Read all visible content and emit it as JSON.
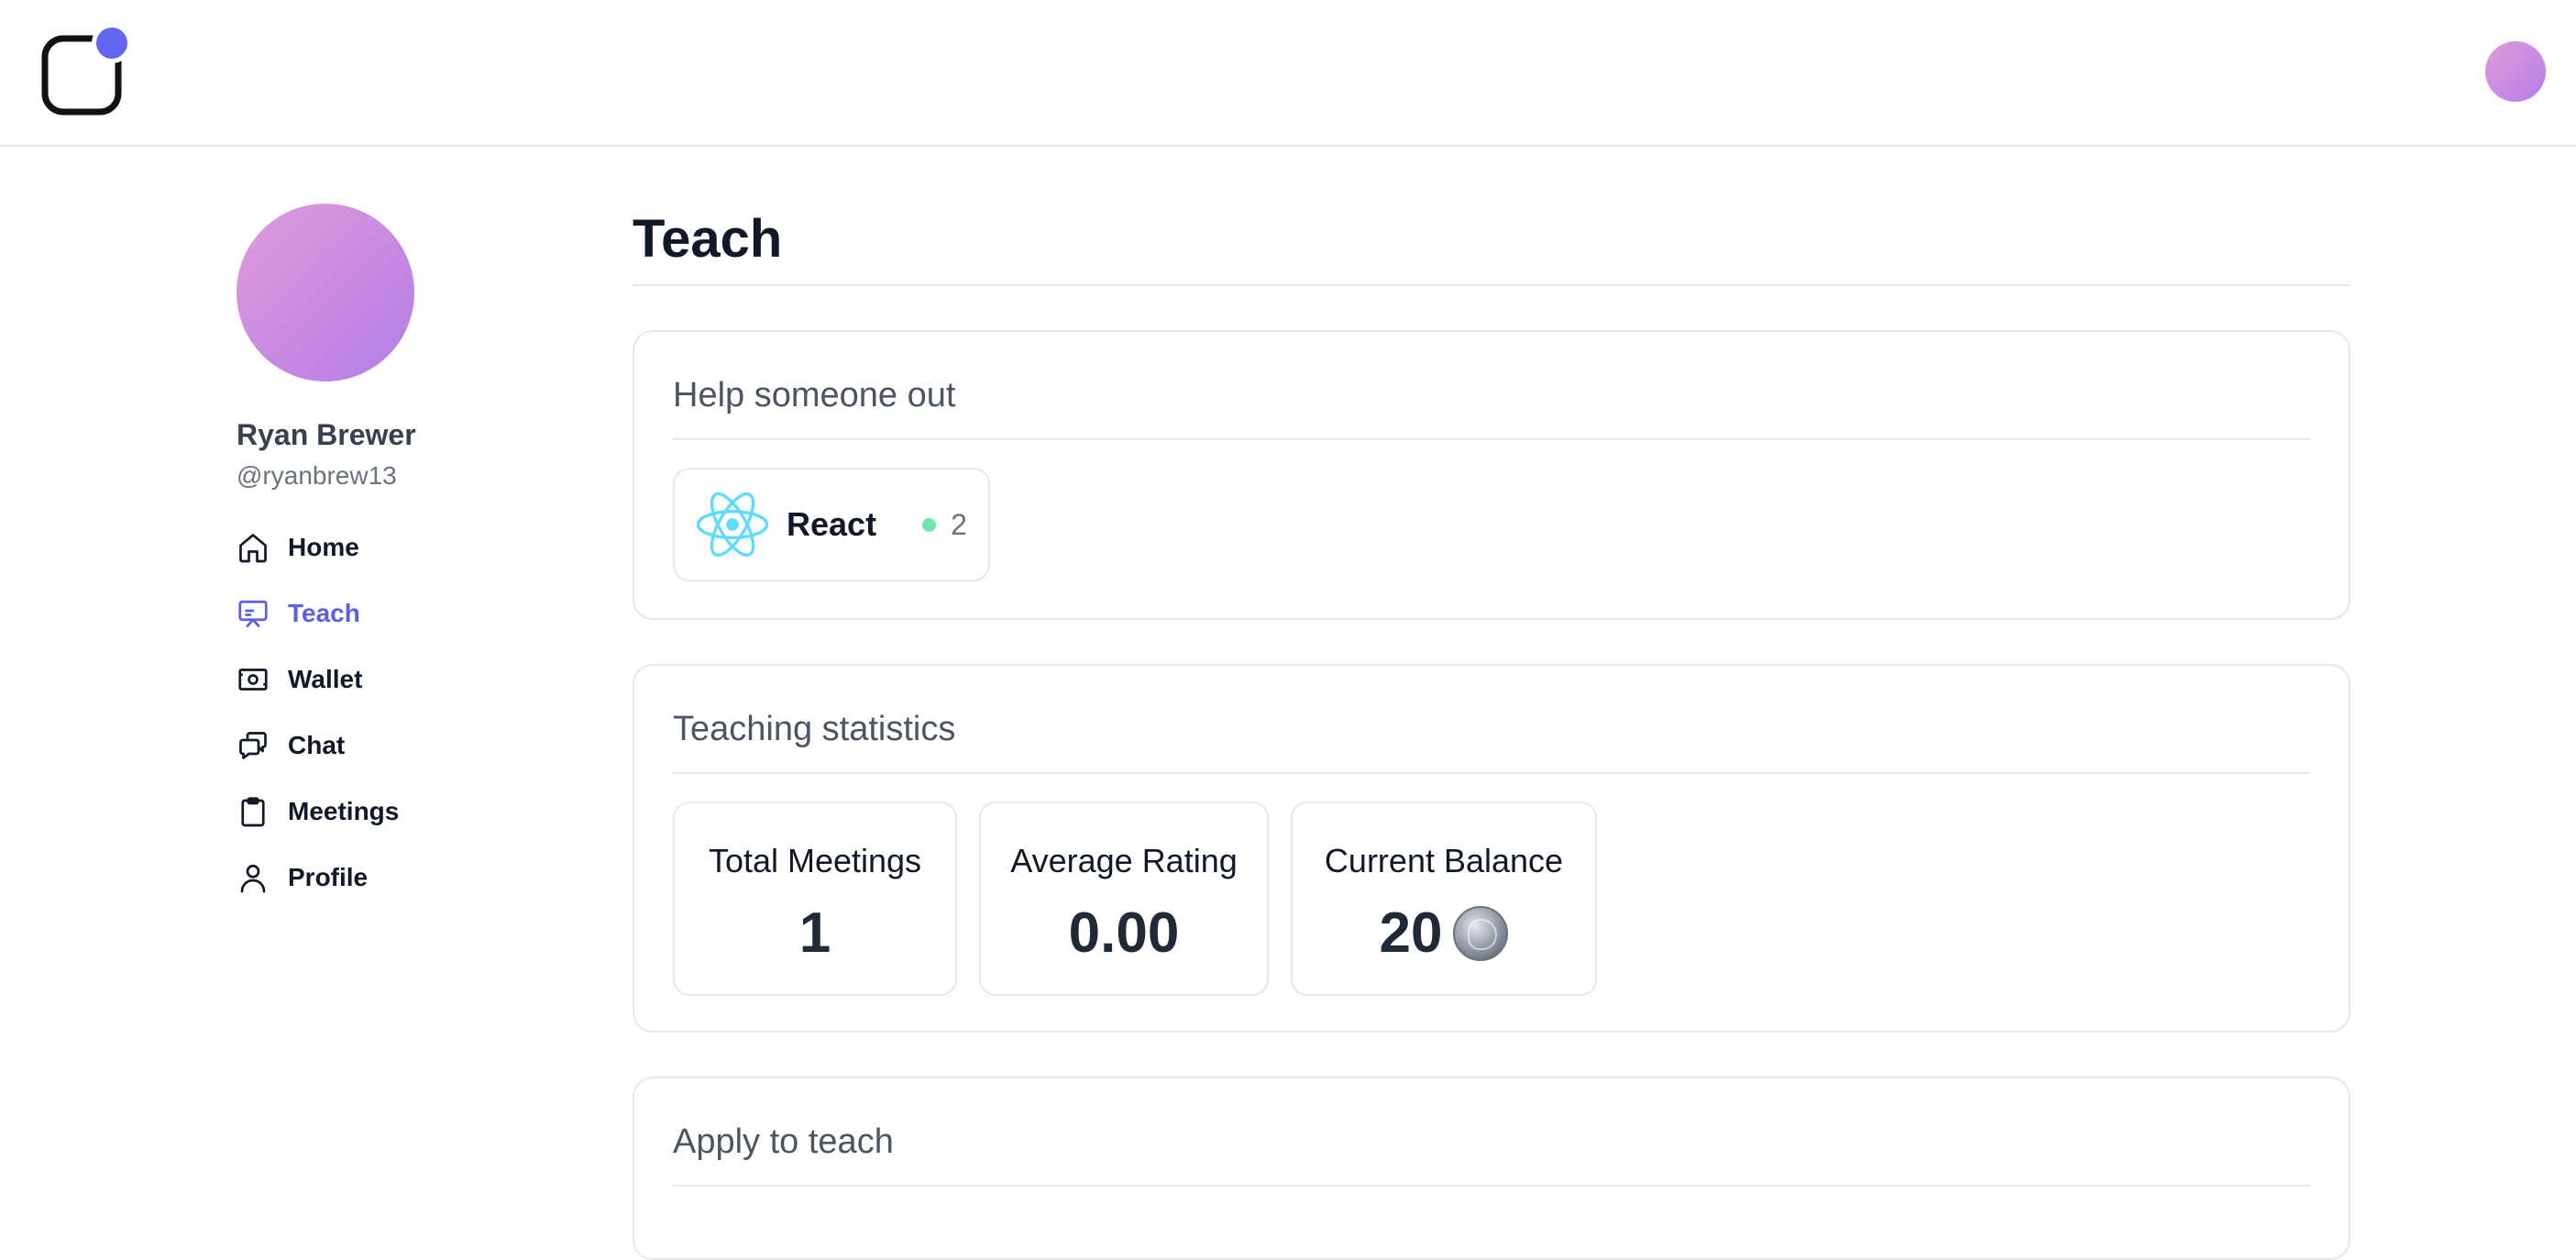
{
  "header": {
    "logo_icon": "app-logo-icon",
    "accent": "#6366f1",
    "avatar_icon": "user-avatar"
  },
  "sidebar": {
    "user": {
      "name": "Ryan Brewer",
      "handle": "@ryanbrew13"
    },
    "items": [
      {
        "label": "Home",
        "icon": "home-icon",
        "active": false
      },
      {
        "label": "Teach",
        "icon": "presentation-icon",
        "active": true
      },
      {
        "label": "Wallet",
        "icon": "cash-icon",
        "active": false
      },
      {
        "label": "Chat",
        "icon": "chat-icon",
        "active": false
      },
      {
        "label": "Meetings",
        "icon": "clipboard-icon",
        "active": false
      },
      {
        "label": "Profile",
        "icon": "user-icon",
        "active": false
      }
    ],
    "active_color": "#5b5fe0"
  },
  "main": {
    "title": "Teach",
    "help_card": {
      "title": "Help someone out",
      "topics": [
        {
          "name": "React",
          "icon": "react-icon",
          "count": "2",
          "status_color": "#6ee7a8"
        }
      ]
    },
    "stats_card": {
      "title": "Teaching statistics",
      "stats": [
        {
          "label": "Total Meetings",
          "value": "1"
        },
        {
          "label": "Average Rating",
          "value": "0.00"
        },
        {
          "label": "Current Balance",
          "value": "20",
          "icon": "coin-icon"
        }
      ]
    },
    "apply_card": {
      "title": "Apply to teach"
    }
  }
}
